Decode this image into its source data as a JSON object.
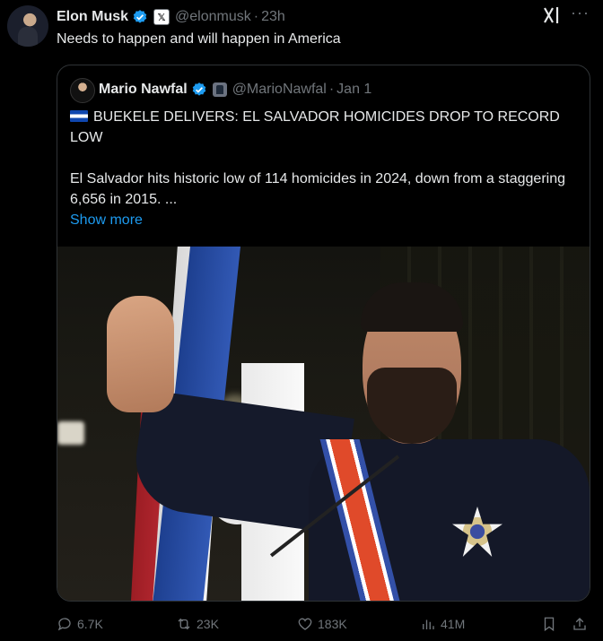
{
  "tweet": {
    "author_name": "Elon Musk",
    "handle": "@elonmusk",
    "time": "23h",
    "text": "Needs to happen and will happen in America"
  },
  "quoted": {
    "author_name": "Mario Nawfal",
    "handle": "@MarioNawfal",
    "time": "Jan 1",
    "headline": "BUEKELE DELIVERS: EL SALVADOR HOMICIDES DROP TO RECORD LOW",
    "body": "El Salvador hits historic low of 114 homicides in 2024, down from a staggering 6,656 in 2015. ...",
    "show_more": "Show more"
  },
  "actions": {
    "replies": "6.7K",
    "reposts": "23K",
    "likes": "183K",
    "views": "41M"
  },
  "icons": {
    "more": "more-dots-icon",
    "grok": "grok-icon",
    "verified": "verified-badge-icon",
    "bookmark": "bookmark-icon",
    "share": "share-icon"
  },
  "colors": {
    "background": "#000000",
    "text": "#e7e9ea",
    "muted": "#71767b",
    "link": "#1d9bf0",
    "verified": "#1d9bf0"
  }
}
